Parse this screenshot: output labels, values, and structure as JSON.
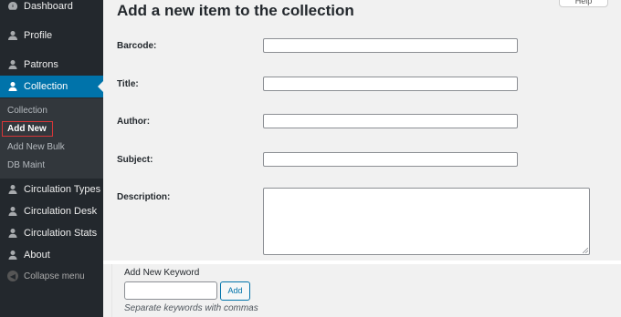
{
  "sidebar": {
    "items": [
      {
        "label": "Dashboard",
        "icon": "dashboard-icon"
      },
      {
        "label": "Profile",
        "icon": "user-icon"
      },
      {
        "label": "Patrons",
        "icon": "patron-icon"
      },
      {
        "label": "Collection",
        "icon": "collection-icon"
      },
      {
        "label": "Circulation Types",
        "icon": "circulation-types-icon"
      },
      {
        "label": "Circulation Desk",
        "icon": "circulation-desk-icon"
      },
      {
        "label": "Circulation Stats",
        "icon": "circulation-stats-icon"
      },
      {
        "label": "About",
        "icon": "about-icon"
      }
    ],
    "submenu": [
      {
        "label": "Collection"
      },
      {
        "label": "Add New"
      },
      {
        "label": "Add New Bulk"
      },
      {
        "label": "DB Maint"
      }
    ],
    "collapse_label": "Collapse menu"
  },
  "main": {
    "title": "Add a new item to the collection",
    "help_label": "Help",
    "fields": {
      "barcode": {
        "label": "Barcode:",
        "value": ""
      },
      "title": {
        "label": "Title:",
        "value": ""
      },
      "author": {
        "label": "Author:",
        "value": ""
      },
      "subject": {
        "label": "Subject:",
        "value": ""
      },
      "description": {
        "label": "Description:",
        "value": ""
      }
    }
  },
  "keywords": {
    "title": "Add New Keyword",
    "input_value": "",
    "button_label": "Add",
    "hint": "Separate keywords with commas"
  },
  "colors": {
    "sidebar_bg": "#23282d",
    "submenu_bg": "#32373c",
    "active_bg": "#0073aa",
    "highlight_border": "#d63638"
  }
}
